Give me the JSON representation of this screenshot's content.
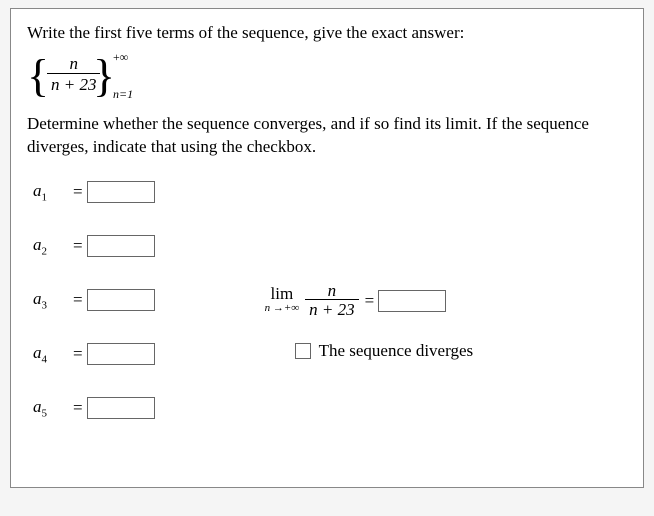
{
  "prompt": "Write the first five terms of the sequence, give the exact answer:",
  "sequence": {
    "numerator": "n",
    "denominator": "n + 23",
    "upper": "+∞",
    "lower": "n=1"
  },
  "instructions": "Determine whether the sequence converges, and if so find its limit. If the sequence diverges, indicate that using the checkbox.",
  "terms": [
    {
      "label_var": "a",
      "label_sub": "1",
      "value": ""
    },
    {
      "label_var": "a",
      "label_sub": "2",
      "value": ""
    },
    {
      "label_var": "a",
      "label_sub": "3",
      "value": ""
    },
    {
      "label_var": "a",
      "label_sub": "4",
      "value": ""
    },
    {
      "label_var": "a",
      "label_sub": "5",
      "value": ""
    }
  ],
  "limit": {
    "lim_text": "lim",
    "lim_sub": "n →+∞",
    "frac_num": "n",
    "frac_den": "n + 23",
    "eq": "=",
    "value": ""
  },
  "diverge": {
    "checked": false,
    "label": "The sequence diverges"
  },
  "eq_sign": "="
}
